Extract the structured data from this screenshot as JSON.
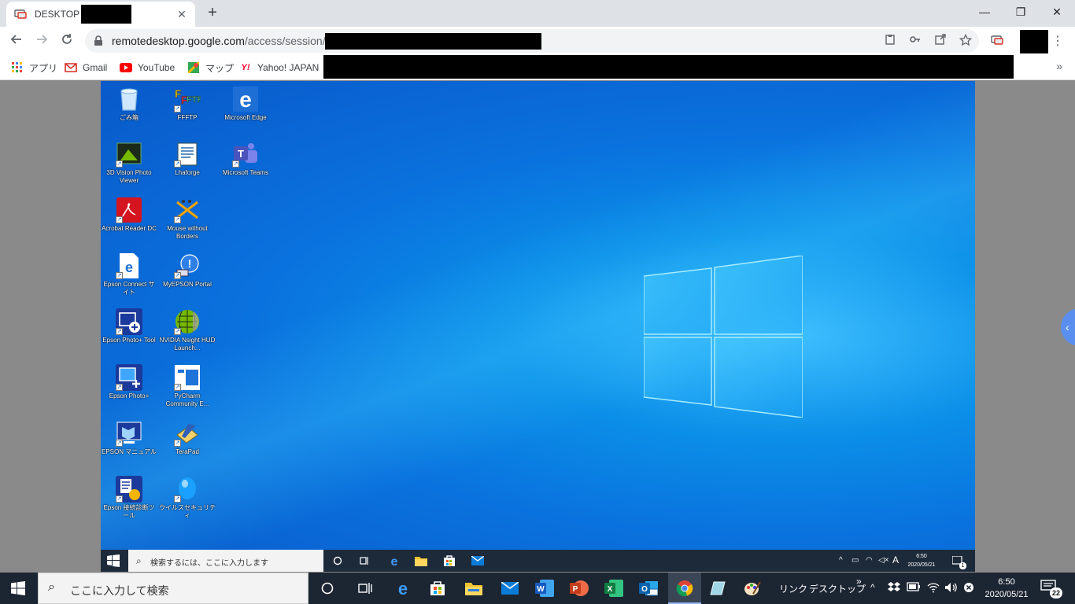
{
  "browser": {
    "tab": {
      "title": "DESKTOP",
      "close": "✕"
    },
    "new_tab": "+",
    "window_controls": {
      "minimize": "—",
      "maximize": "❐",
      "close": "✕"
    },
    "url": {
      "host": "remotedesktop.google.com",
      "path": "/access/session/"
    },
    "bookmarks": [
      {
        "label": "アプリ",
        "icon": "apps-grid-icon"
      },
      {
        "label": "Gmail",
        "icon": "gmail-icon"
      },
      {
        "label": "YouTube",
        "icon": "youtube-icon"
      },
      {
        "label": "マップ",
        "icon": "maps-icon"
      },
      {
        "label": "Yahoo! JAPAN",
        "icon": "yahoo-icon"
      }
    ],
    "bookmarks_more": "»"
  },
  "remote_desktop": {
    "icons": [
      {
        "label": "ごみ箱"
      },
      {
        "label": "FFFTP"
      },
      {
        "label": "Microsoft Edge"
      },
      {
        "label": "3D Vision Photo Viewer"
      },
      {
        "label": "Lhaforge"
      },
      {
        "label": "Microsoft Teams"
      },
      {
        "label": "Acrobat Reader DC"
      },
      {
        "label": "Mouse without Borders"
      },
      {
        "label": "Epson Connect サイト"
      },
      {
        "label": "MyEPSON Portal"
      },
      {
        "label": "Epson Photo+ Tool"
      },
      {
        "label": "NVIDIA Nsight HUD Launch..."
      },
      {
        "label": "Epson Photo+"
      },
      {
        "label": "PyCharm Community E..."
      },
      {
        "label": "EPSON マニュアル"
      },
      {
        "label": "TeraPad"
      },
      {
        "label": "Epson 接続診断ツール"
      },
      {
        "label": "ウイルスセキュリティ"
      }
    ],
    "taskbar": {
      "search_placeholder": "検索するには、ここに入力します",
      "ime": "A",
      "time": "6:50",
      "date": "2020/05/21",
      "notification_count": "1"
    }
  },
  "taskbar": {
    "search_placeholder": "ここに入力して検索",
    "toolbar_links": "リンク",
    "toolbar_desktop": "デスクトップ",
    "toolbar_more": "»",
    "time": "6:50",
    "date": "2020/05/21",
    "notification_count": "22"
  },
  "colors": {
    "desktop_blue": "#0a72de",
    "taskbar": "#1c2532",
    "chrome_tabstrip": "#dee1e6"
  }
}
